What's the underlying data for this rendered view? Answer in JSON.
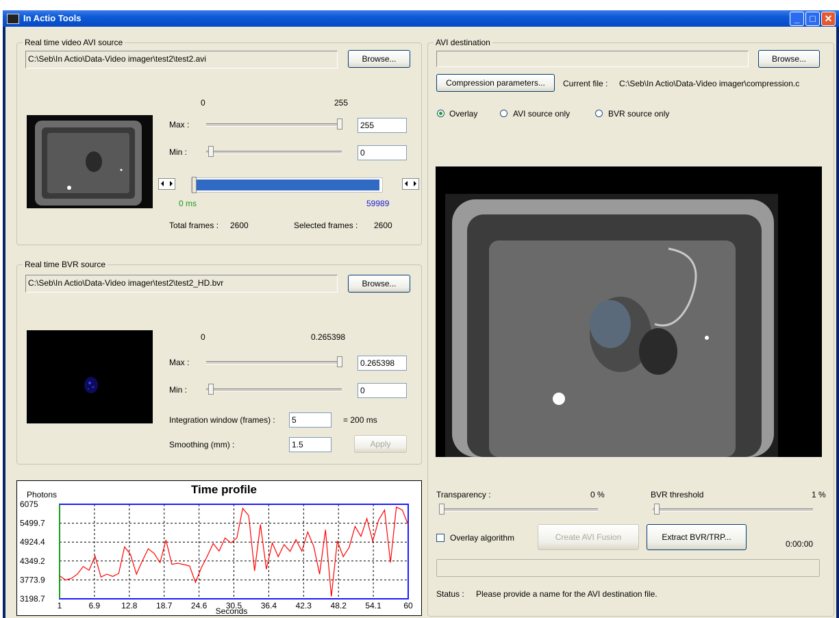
{
  "window": {
    "title": "In Actio Tools"
  },
  "avi_source": {
    "group_label": "Real time video AVI source",
    "path": "C:\\Seb\\In Actio\\Data-Video imager\\test2\\test2.avi",
    "browse_label": "Browse...",
    "range_min": "0",
    "range_max": "255",
    "max_label": "Max :",
    "max_value": "255",
    "min_label": "Min :",
    "min_value": "0",
    "start_label": "0 ms",
    "end_label": "59989",
    "total_frames_label": "Total frames :",
    "total_frames": "2600",
    "selected_frames_label": "Selected frames :",
    "selected_frames": "2600"
  },
  "bvr_source": {
    "group_label": "Real time BVR source",
    "path": "C:\\Seb\\In Actio\\Data-Video imager\\test2\\test2_HD.bvr",
    "browse_label": "Browse...",
    "range_min": "0",
    "range_max": "0.265398",
    "max_label": "Max :",
    "max_value": "0.265398",
    "min_label": "Min :",
    "min_value": "0",
    "integration_label": "Integration window (frames) :",
    "integration_value": "5",
    "integration_ms": "= 200 ms",
    "smoothing_label": "Smoothing (mm) :",
    "smoothing_value": "1.5",
    "apply_label": "Apply"
  },
  "avi_destination": {
    "group_label": "AVI destination",
    "path": "",
    "browse_label": "Browse...",
    "compression_label": "Compression parameters...",
    "current_file_label": "Current file :",
    "current_file": "C:\\Seb\\In Actio\\Data-Video imager\\compression.c",
    "radio_overlay": "Overlay",
    "radio_avi": "AVI source only",
    "radio_bvr": "BVR source only",
    "transparency_label": "Transparency :",
    "transparency_value": "0 %",
    "transparency_fraction": 0.0,
    "threshold_label": "BVR threshold",
    "threshold_value": "1 %",
    "threshold_fraction": 0.01,
    "overlay_algorithm_label": "Overlay algorithm",
    "create_fusion_label": "Create AVI Fusion",
    "extract_label": "Extract BVR/TRP...",
    "time": "0:00:00",
    "status_label": "Status :",
    "status_text": "Please provide a name for the AVI destination file."
  },
  "chart_data": {
    "type": "line",
    "title": "Time profile",
    "ylabel": "Photons",
    "xlabel": "Seconds",
    "xlim": [
      1,
      60
    ],
    "ylim": [
      3198.7,
      6075
    ],
    "x_ticks": [
      "1",
      "6.9",
      "12.8",
      "18.7",
      "24.6",
      "30.5",
      "36.4",
      "42.3",
      "48.2",
      "54.1",
      "60"
    ],
    "y_ticks": [
      "6075",
      "5499.7",
      "4924.4",
      "4349.2",
      "3773.9",
      "3198.7"
    ],
    "series": [
      {
        "color": "#ff0000",
        "x": [
          1,
          2,
          3,
          4,
          5,
          6,
          7,
          8,
          9,
          10,
          11,
          12,
          13,
          14,
          15,
          16,
          17,
          18,
          19,
          20,
          21,
          22,
          23,
          24,
          25,
          26,
          27,
          28,
          29,
          30,
          31,
          32,
          33,
          34,
          35,
          36,
          37,
          38,
          39,
          40,
          41,
          42,
          43,
          44,
          45,
          46,
          47,
          48,
          49,
          50,
          51,
          52,
          53,
          54,
          55,
          56,
          57,
          58,
          59,
          60
        ],
        "y": [
          3900,
          3770,
          3820,
          3950,
          4180,
          4070,
          4500,
          3860,
          3950,
          3880,
          3970,
          4780,
          4550,
          3950,
          4350,
          4720,
          4580,
          4300,
          4990,
          4250,
          4280,
          4240,
          4200,
          3700,
          4150,
          4500,
          4880,
          4650,
          5050,
          4900,
          5050,
          5950,
          5730,
          4050,
          5460,
          4100,
          4900,
          4480,
          4850,
          4640,
          5000,
          4650,
          5230,
          4800,
          3950,
          5300,
          3270,
          4960,
          4480,
          4760,
          5400,
          5100,
          5640,
          4950,
          5600,
          5900,
          4300,
          5990,
          5900,
          5450
        ]
      }
    ]
  }
}
